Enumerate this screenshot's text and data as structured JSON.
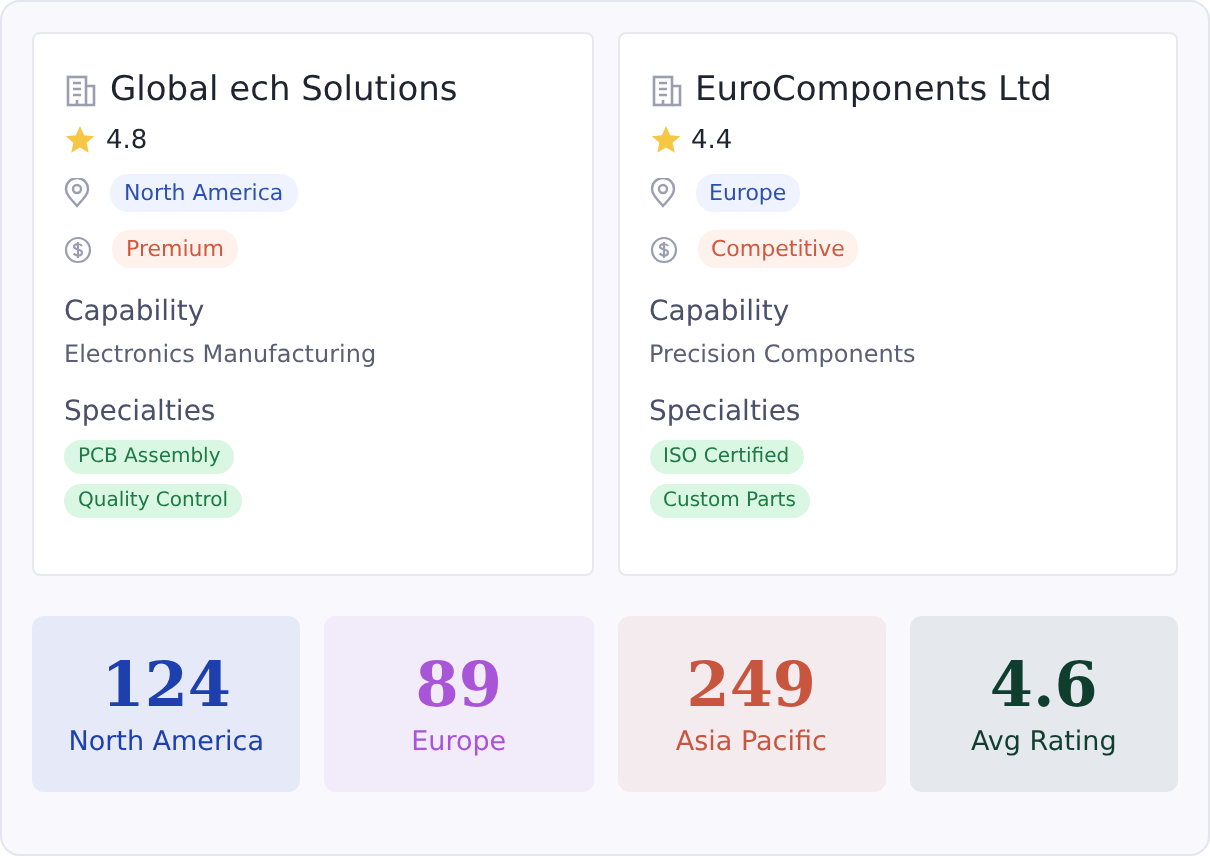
{
  "suppliers": [
    {
      "name": "Global ech Solutions",
      "rating": "4.8",
      "stars": 1,
      "region": "North America",
      "pricing": "Premium",
      "capability_label": "Capability",
      "capability": "Electronics Manufacturing",
      "specialties_label": "Specialties",
      "specialties": [
        "PCB Assembly",
        "Quality Control"
      ]
    },
    {
      "name": "EuroComponents Ltd",
      "rating": "4.4",
      "stars": 1,
      "region": "Europe",
      "pricing": "Competitive",
      "capability_label": "Capability",
      "capability": "Precision Components",
      "specialties_label": "Specialties",
      "specialties": [
        "ISO Certified",
        "Custom Parts"
      ]
    }
  ],
  "stats": [
    {
      "value": "124",
      "label": "North America",
      "color": "#1e40af"
    },
    {
      "value": "89",
      "label": "Europe",
      "color": "#a855d7"
    },
    {
      "value": "249",
      "label": "Asia Pacific",
      "color": "#c8553d"
    },
    {
      "value": "4.6",
      "label": "Avg Rating",
      "color": "#0f3d2e"
    }
  ]
}
